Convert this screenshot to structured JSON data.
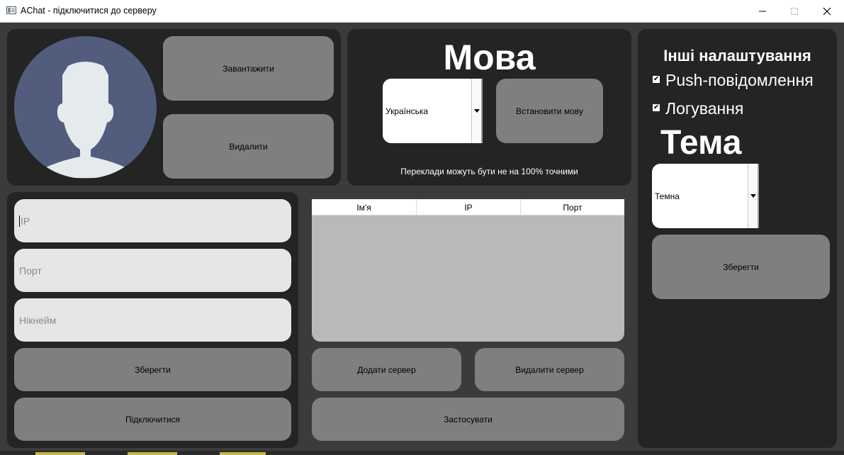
{
  "window": {
    "title": "AChat - підключитися до серверу",
    "minimize_glyph": "—",
    "maximize_glyph": "☐",
    "close_glyph": "✕"
  },
  "profile": {
    "upload_label": "Завантажити",
    "delete_label": "Видалити",
    "avatar_icon": "default-user-avatar",
    "avatar_bg": "#525c7d",
    "avatar_fg": "#e5eaed"
  },
  "language": {
    "heading": "Мова",
    "selected": "Українська",
    "set_label": "Встановити мову",
    "note": "Переклади можуть бути не на 100% точними"
  },
  "connect": {
    "ip_placeholder": "IP",
    "port_placeholder": "Порт",
    "nick_placeholder": "Нікнейм",
    "save_label": "Зберегти",
    "connect_label": "Підключитися"
  },
  "servers": {
    "columns": [
      "Ім'я",
      "IP",
      "Порт"
    ],
    "rows": [],
    "add_label": "Додати сервер",
    "remove_label": "Видалити сервер",
    "apply_label": "Застосувати"
  },
  "other_settings": {
    "heading": "Інші налаштування",
    "push_label": "Push-повідомлення",
    "push_checked": true,
    "logging_label": "Логування",
    "logging_checked": true,
    "theme_heading": "Тема",
    "theme_selected": "Темна",
    "save_label": "Зберегти"
  },
  "colors": {
    "background": "#3b3b3b",
    "panel": "#242424",
    "button": "#7f7f7f",
    "input": "#e6e6e6",
    "table_body": "#b9b9b9"
  }
}
